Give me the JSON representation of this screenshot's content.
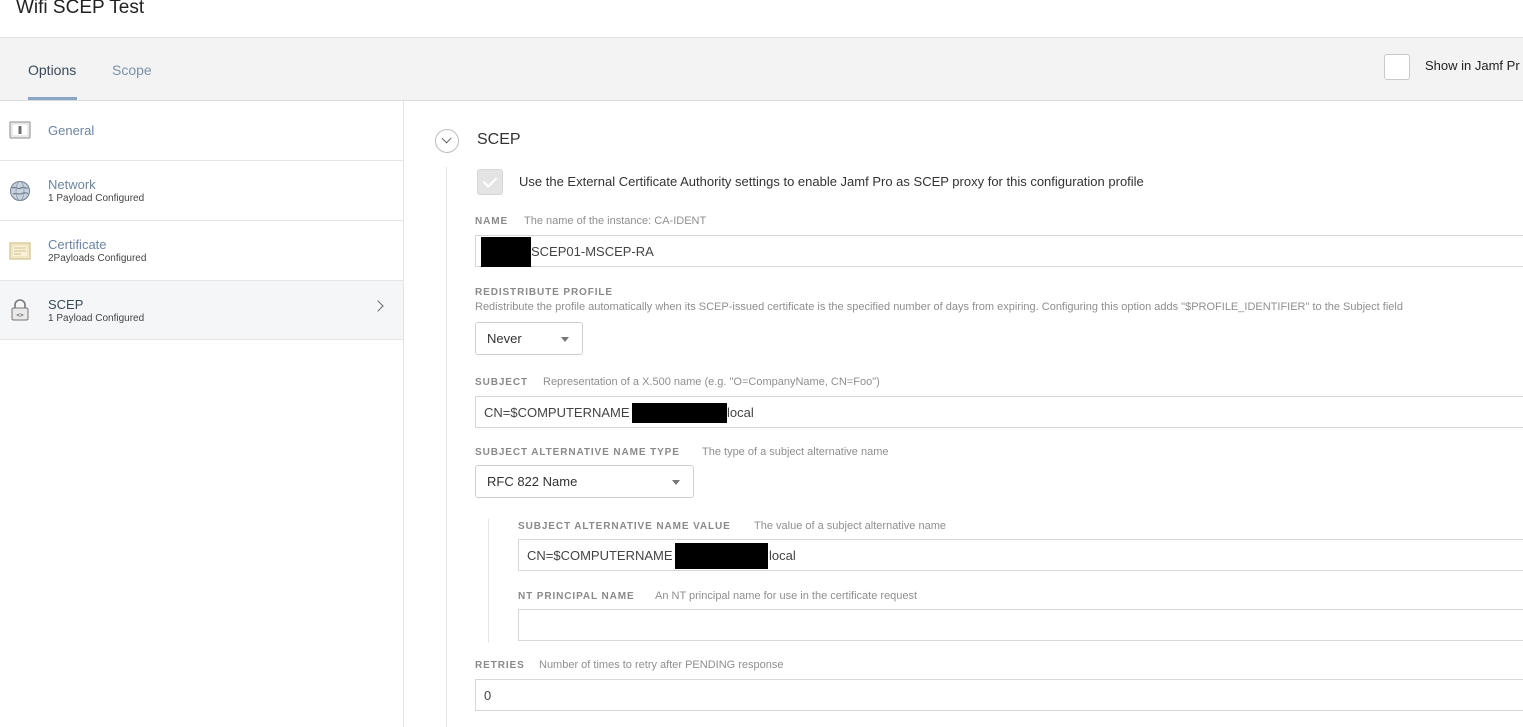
{
  "window": {
    "title": "Wifi SCEP Test"
  },
  "tabs": [
    {
      "label": "Options",
      "active": true
    },
    {
      "label": "Scope",
      "active": false
    }
  ],
  "show_in_jamf": {
    "label": "Show in Jamf Pr",
    "checked": false
  },
  "sidebar": {
    "items": [
      {
        "label": "General",
        "sub": "",
        "icon": "general-icon",
        "selected": false
      },
      {
        "label": "Network",
        "sub": "1 Payload Configured",
        "icon": "globe-icon",
        "selected": false
      },
      {
        "label": "Certificate",
        "sub": "2Payloads Configured",
        "icon": "certificate-icon",
        "selected": false
      },
      {
        "label": "SCEP",
        "sub": "1 Payload Configured",
        "icon": "lock-icon",
        "selected": true
      }
    ]
  },
  "scep": {
    "section_title": "SCEP",
    "proxy_checkbox_label": "Use the External Certificate Authority settings to enable Jamf Pro as SCEP proxy for this configuration profile",
    "proxy_checked": true,
    "name": {
      "label": "NAME",
      "desc": "The name of the instance: CA-IDENT",
      "value": "SCEP01-MSCEP-RA"
    },
    "redistribute": {
      "label": "REDISTRIBUTE PROFILE",
      "desc": "Redistribute the profile automatically when its SCEP-issued certificate is the specified number of days from expiring. Configuring this option adds \"$PROFILE_IDENTIFIER\" to the Subject field",
      "value": "Never"
    },
    "subject": {
      "label": "SUBJECT",
      "desc": "Representation of a X.500 name (e.g. \"O=CompanyName, CN=Foo\")",
      "value_prefix": "CN=$COMPUTERNAME",
      "value_suffix": "local"
    },
    "san_type": {
      "label": "SUBJECT ALTERNATIVE NAME TYPE",
      "desc": "The type of a subject alternative name",
      "value": "RFC 822 Name"
    },
    "san_value": {
      "label": "SUBJECT ALTERNATIVE NAME VALUE",
      "desc": "The value of a subject alternative name",
      "value_prefix": "CN=$COMPUTERNAME",
      "value_suffix": "local"
    },
    "nt_principal": {
      "label": "NT PRINCIPAL NAME",
      "desc": "An NT principal name for use in the certificate request",
      "value": ""
    },
    "retries": {
      "label": "RETRIES",
      "desc": "Number of times to retry after PENDING response",
      "value": "0"
    }
  }
}
